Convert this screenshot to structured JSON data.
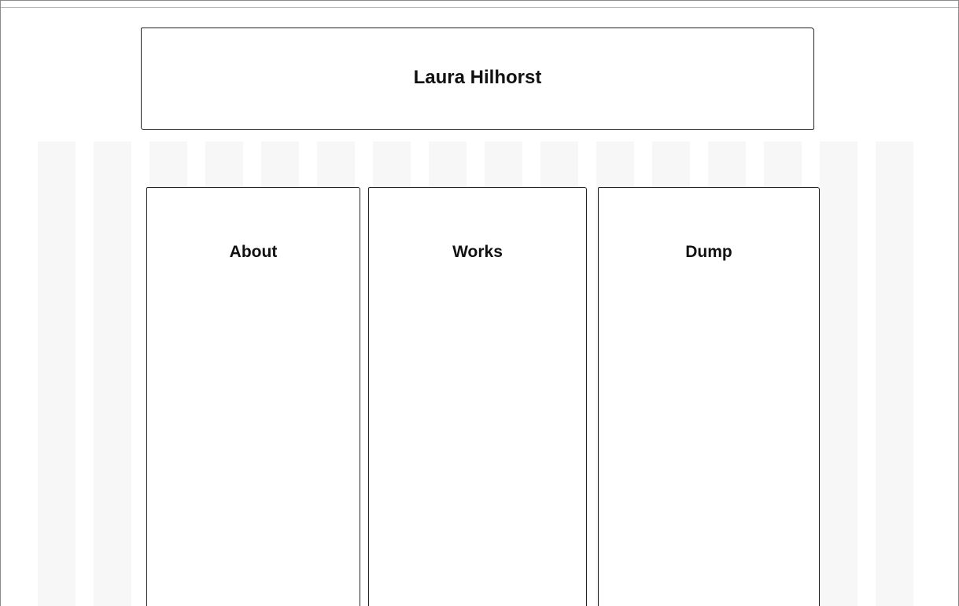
{
  "header": {
    "title": "Laura Hilhorst"
  },
  "panels": [
    {
      "label": "About"
    },
    {
      "label": "Works"
    },
    {
      "label": "Dump"
    }
  ]
}
